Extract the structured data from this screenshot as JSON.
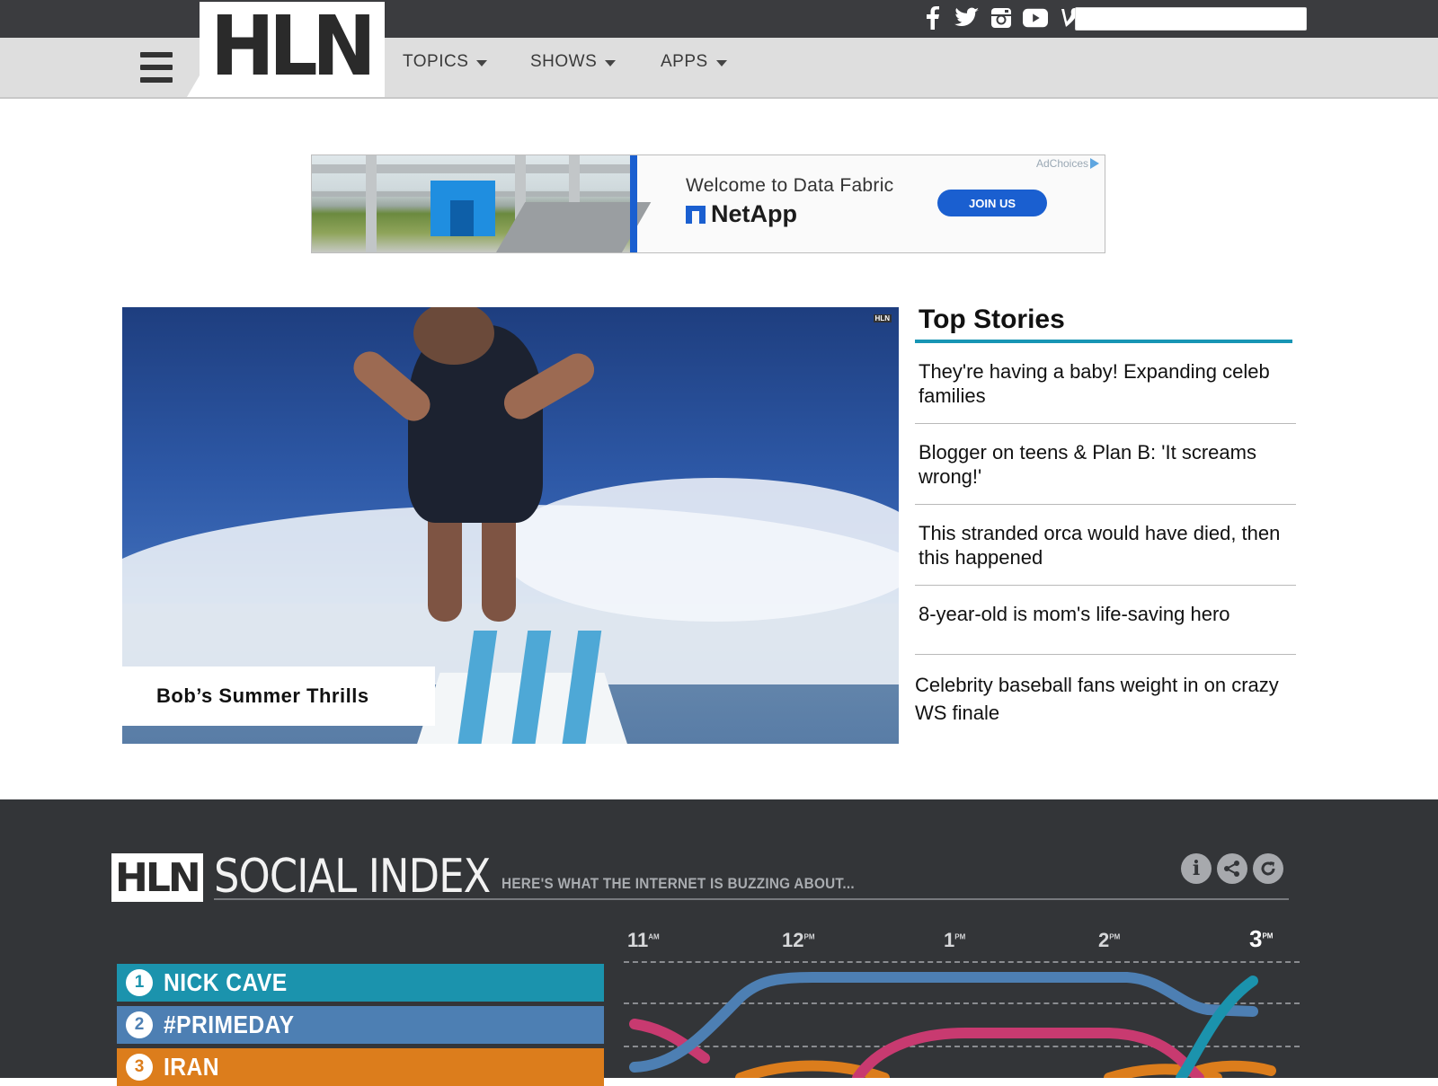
{
  "site": {
    "logo": "HLN"
  },
  "topbar": {
    "social_icons": [
      "facebook-icon",
      "twitter-icon",
      "instagram-icon",
      "youtube-icon",
      "vine-icon"
    ],
    "search": {
      "value": "",
      "placeholder": ""
    }
  },
  "nav": {
    "items": [
      {
        "label": "TOPICS"
      },
      {
        "label": "SHOWS"
      },
      {
        "label": "APPS"
      }
    ]
  },
  "ad": {
    "adchoices": "AdChoices",
    "headline": "Welcome to Data Fabric",
    "brand": "NetApp",
    "cta": "JOIN US"
  },
  "hero": {
    "caption": "Bob’s Summer Thrills",
    "watermark": "HLN"
  },
  "top_stories": {
    "title": "Top Stories",
    "items": [
      "They're having a baby! Expanding celeb families",
      "Blogger on teens & Plan B: 'It screams wrong!'",
      "This stranded orca would have died, then this happened",
      "8-year-old is mom's life-saving hero",
      "Celebrity baseball fans weight in on crazy WS finale"
    ]
  },
  "social_index": {
    "logo": "HLN",
    "title": "SOCIAL INDEX",
    "subtitle": "HERE'S WHAT THE INTERNET IS BUZZING ABOUT...",
    "action_icons": [
      "info-icon",
      "share-icon",
      "refresh-icon"
    ],
    "times": [
      {
        "hour": "11",
        "suffix": "AM"
      },
      {
        "hour": "12",
        "suffix": "PM"
      },
      {
        "hour": "1",
        "suffix": "PM"
      },
      {
        "hour": "2",
        "suffix": "PM"
      },
      {
        "hour": "3",
        "suffix": "PM"
      }
    ],
    "rankings": [
      {
        "rank": "1",
        "label": "NICK CAVE",
        "color": "#1b93ad"
      },
      {
        "rank": "2",
        "label": "#PRIMEDAY",
        "color": "#4d7fb3"
      },
      {
        "rank": "3",
        "label": "IRAN",
        "color": "#dc7d1c"
      }
    ]
  },
  "colors": {
    "accent_teal": "#1795b4",
    "topbar": "#3b3c3f",
    "navbar": "#dedede",
    "ad_blue": "#1a5fd0",
    "social_bg": "#333538"
  }
}
